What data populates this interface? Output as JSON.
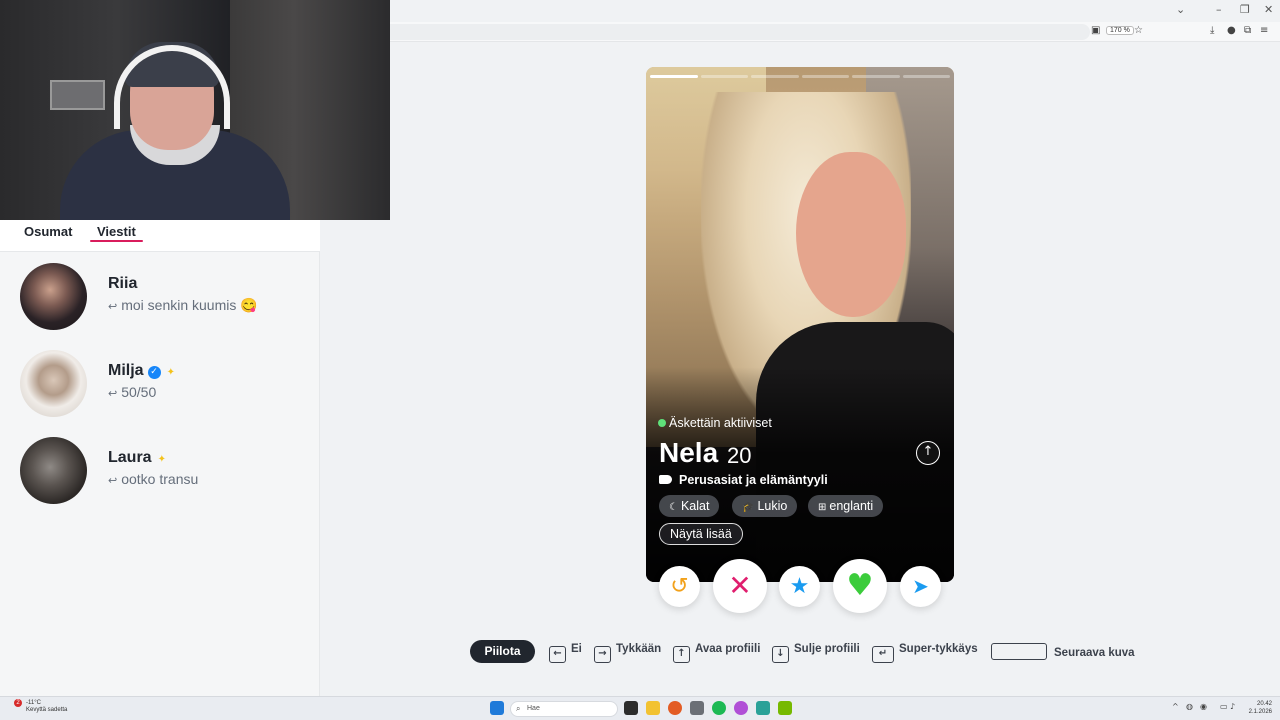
{
  "browser": {
    "window_controls": [
      "⌄",
      "–",
      "❐",
      "✕"
    ],
    "zoom": "170 %",
    "toolbar_icons": [
      "reader-icon",
      "star-icon",
      "download-icon",
      "account-icon",
      "extensions-icon",
      "menu-icon"
    ]
  },
  "sidebar": {
    "tabs": [
      {
        "label": "Osumat",
        "active": false
      },
      {
        "label": "Viestit",
        "active": true
      }
    ],
    "messages": [
      {
        "name": "Riia",
        "preview": "moi senkin kuumis 😋",
        "verified": false,
        "sparkle": false
      },
      {
        "name": "Milja",
        "preview": "50/50",
        "verified": true,
        "sparkle": true
      },
      {
        "name": "Laura",
        "preview": "ootko transu",
        "verified": false,
        "sparkle": true
      }
    ]
  },
  "card": {
    "status": "Äskettäin aktiiviset",
    "name": "Nela",
    "age": "20",
    "basics_label": "Perusasiat ja elämäntyyli",
    "chips": [
      {
        "icon": "moon-icon",
        "label": "Kalat"
      },
      {
        "icon": "graduation-cap-icon",
        "label": "Lukio"
      },
      {
        "icon": "translate-icon",
        "label": "englanti"
      }
    ],
    "more_label": "Näytä lisää",
    "photos_total": 6,
    "photo_current": 1
  },
  "actions": {
    "rewind_icon": "↺",
    "nope_icon": "✕",
    "superlike_icon": "★",
    "like_icon": "♥",
    "boost_icon": "➤"
  },
  "shortcuts": {
    "hide": "Piilota",
    "items": [
      {
        "key": "←",
        "label": "Ei"
      },
      {
        "key": "→",
        "label": "Tykkään"
      },
      {
        "key": "↑",
        "label": "Avaa profiili"
      },
      {
        "key": "↓",
        "label": "Sulje profiili"
      },
      {
        "key": "↵",
        "label": "Super-tykkäys"
      },
      {
        "key": "",
        "label": "Seuraava kuva"
      }
    ]
  },
  "taskbar": {
    "weather_badge": "2",
    "weather_temp": "-11°C",
    "weather_desc": "Kevyttä sadetta",
    "search_placeholder": "Hae",
    "time": "20.42",
    "date": "2.1.2026"
  },
  "colors": {
    "accent": "#d91c5c",
    "verified": "#1786f9",
    "nope": "#e01e6e",
    "like": "#3bcc3b",
    "superlike": "#1a9bf0",
    "rewind": "#f2a11b"
  }
}
